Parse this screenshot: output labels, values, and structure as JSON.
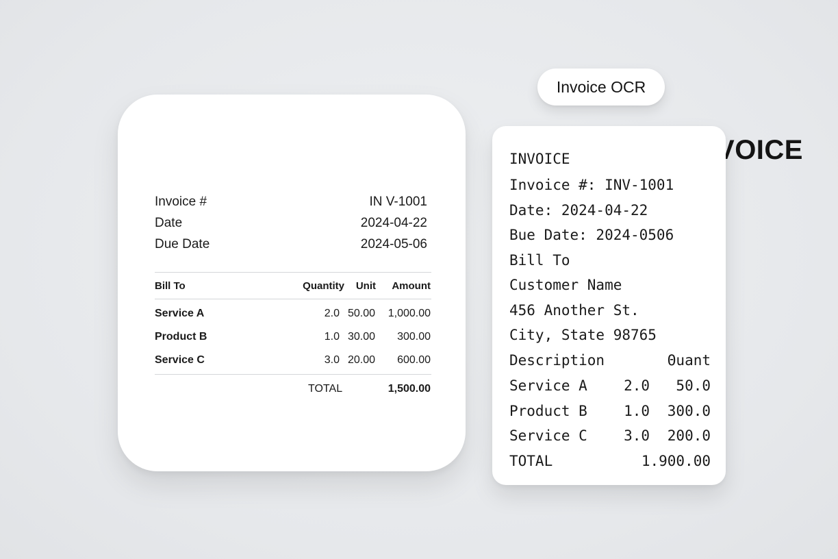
{
  "invoice": {
    "title": "INVOICE",
    "meta": [
      {
        "label": "Invoice #",
        "value": "IN V-1001"
      },
      {
        "label": "Date",
        "value": "2024-04-22"
      },
      {
        "label": "Due Date",
        "value": "2024-05-06"
      }
    ],
    "table": {
      "headers": {
        "bill_to": "Bill To",
        "quantity": "Quantity",
        "unit": "Unit",
        "amount": "Amount"
      },
      "rows": [
        {
          "description": "Service A",
          "quantity": "2.0",
          "unit": "50.00",
          "amount": "1,000.00"
        },
        {
          "description": "Product B",
          "quantity": "1.0",
          "unit": "30.00",
          "amount": "300.00"
        },
        {
          "description": "Service C",
          "quantity": "3.0",
          "unit": "20.00",
          "amount": "600.00"
        }
      ],
      "total_label": "TOTAL",
      "total_value": "1,500.00"
    }
  },
  "ocr": {
    "pill_label": "Invoice OCR",
    "lines": [
      "INVOICE",
      "Invoice #: INV-1001",
      "Date: 2024-04-22",
      "Bue Date: 2024-0506",
      "Bill To",
      "Customer Name",
      "456 Another St.",
      "City, State 98765"
    ],
    "table_header": {
      "description": "Description",
      "quant": "Θuant"
    },
    "rows": [
      {
        "description": "Service A",
        "qty": "2.0",
        "value": "50.0"
      },
      {
        "description": "Product B",
        "qty": "1.0",
        "value": "300.0"
      },
      {
        "description": "Service C",
        "qty": "3.0",
        "value": "200.0"
      }
    ],
    "total_label": "TOTAL",
    "total_value": "1.900.00"
  }
}
